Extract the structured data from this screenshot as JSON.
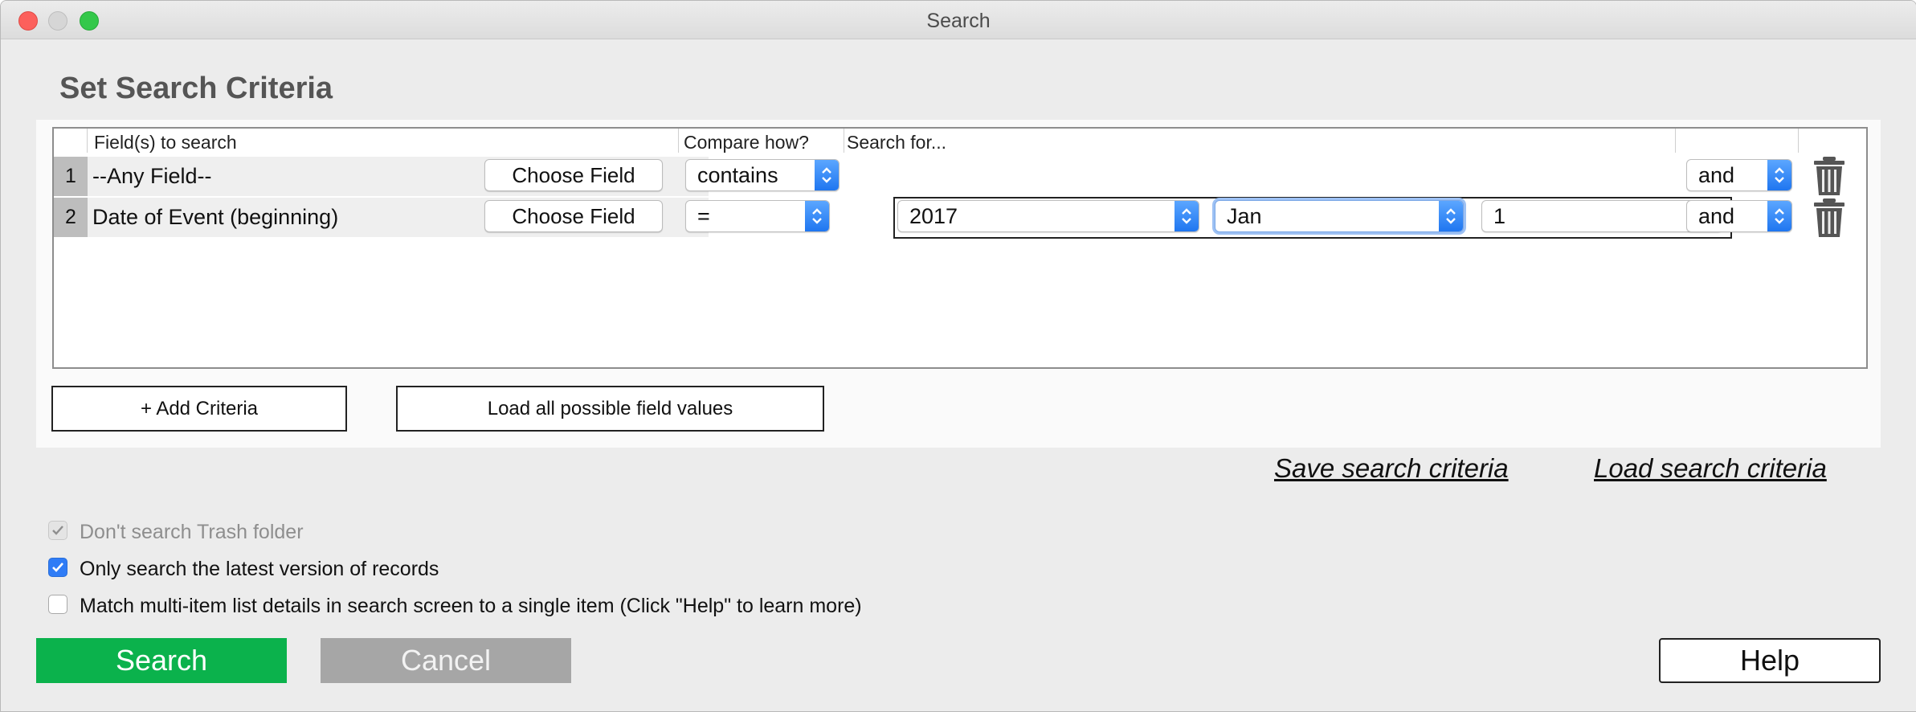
{
  "window": {
    "title": "Search"
  },
  "heading": "Set Search Criteria",
  "columns": {
    "fields": "Field(s) to search",
    "compare": "Compare how?",
    "search_for": "Search for..."
  },
  "rows": [
    {
      "num": "1",
      "field": "--Any Field--",
      "choose_label": "Choose Field",
      "compare": "contains",
      "conjunction": "and"
    },
    {
      "num": "2",
      "field": "Date of Event (beginning)",
      "choose_label": "Choose Field",
      "compare": "=",
      "year": "2017",
      "month": "Jan",
      "day": "1",
      "conjunction": "and"
    }
  ],
  "actions": {
    "add_criteria": "+ Add Criteria",
    "load_values": "Load all possible field values"
  },
  "links": {
    "save": "Save search criteria",
    "load": "Load search criteria"
  },
  "options": [
    {
      "label": "Don't search Trash folder",
      "state": "checked-disabled"
    },
    {
      "label": "Only search the latest version of records",
      "state": "checked"
    },
    {
      "label": "Match multi-item list details in search screen to a single item (Click \"Help\" to learn more)",
      "state": "unchecked"
    }
  ],
  "buttons": {
    "search": "Search",
    "cancel": "Cancel",
    "help": "Help"
  },
  "colors": {
    "search_button": "#0bb24c",
    "cancel_button": "#a6a6a6",
    "accent": "#2f7cf6"
  }
}
